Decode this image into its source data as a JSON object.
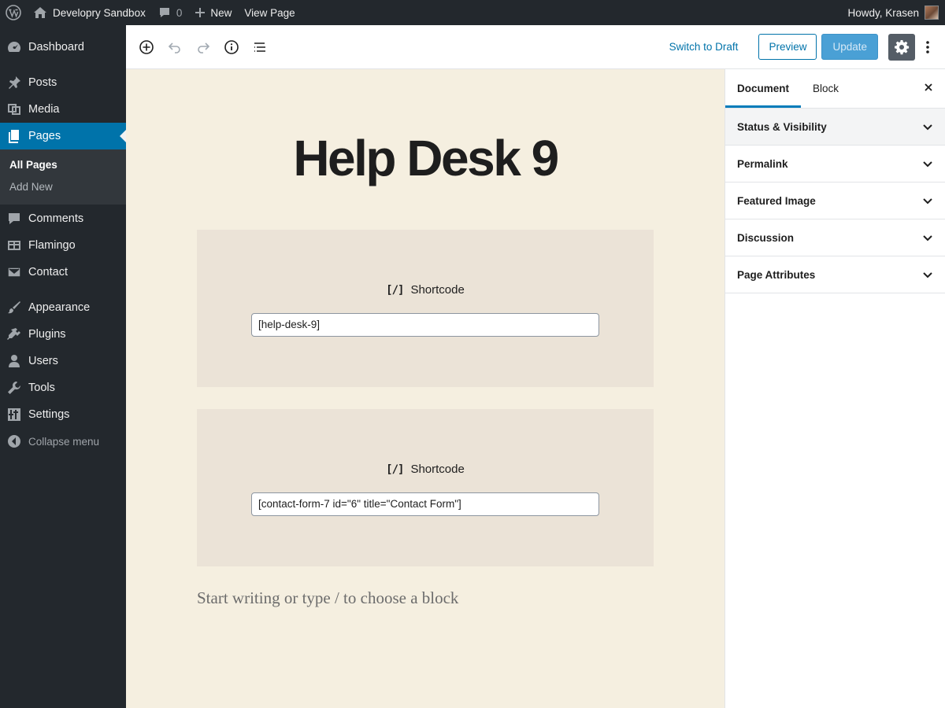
{
  "admin_bar": {
    "site_name": "Developry Sandbox",
    "comments_count": "0",
    "new_label": "New",
    "view_page": "View Page",
    "greeting": "Howdy, Krasen"
  },
  "sidebar": {
    "items": [
      {
        "label": "Dashboard",
        "icon": "dashboard-icon"
      },
      {
        "label": "Posts",
        "icon": "pin-icon"
      },
      {
        "label": "Media",
        "icon": "media-icon"
      },
      {
        "label": "Pages",
        "icon": "pages-icon"
      },
      {
        "label": "Comments",
        "icon": "comment-icon"
      },
      {
        "label": "Flamingo",
        "icon": "flamingo-icon"
      },
      {
        "label": "Contact",
        "icon": "mail-icon"
      },
      {
        "label": "Appearance",
        "icon": "brush-icon"
      },
      {
        "label": "Plugins",
        "icon": "plugin-icon"
      },
      {
        "label": "Users",
        "icon": "users-icon"
      },
      {
        "label": "Tools",
        "icon": "wrench-icon"
      },
      {
        "label": "Settings",
        "icon": "settings-icon"
      }
    ],
    "submenu": [
      "All Pages",
      "Add New"
    ],
    "collapse_label": "Collapse menu"
  },
  "header": {
    "switch_to_draft": "Switch to Draft",
    "preview": "Preview",
    "update": "Update"
  },
  "editor": {
    "title": "Help Desk 9",
    "blocks": [
      {
        "label": "Shortcode",
        "icon": "[/]",
        "value": "[help-desk-9]"
      },
      {
        "label": "Shortcode",
        "icon": "[/]",
        "value": "[contact-form-7 id=\"6\" title=\"Contact Form\"]"
      }
    ],
    "appender_placeholder": "Start writing or type / to choose a block"
  },
  "settings_sidebar": {
    "tabs": [
      "Document",
      "Block"
    ],
    "panels": [
      "Status & Visibility",
      "Permalink",
      "Featured Image",
      "Discussion",
      "Page Attributes"
    ]
  },
  "colors": {
    "admin_dark": "#23282d",
    "accent_blue": "#0073aa",
    "canvas_bg": "#f5efe0",
    "block_bg": "#ebe3d7"
  }
}
